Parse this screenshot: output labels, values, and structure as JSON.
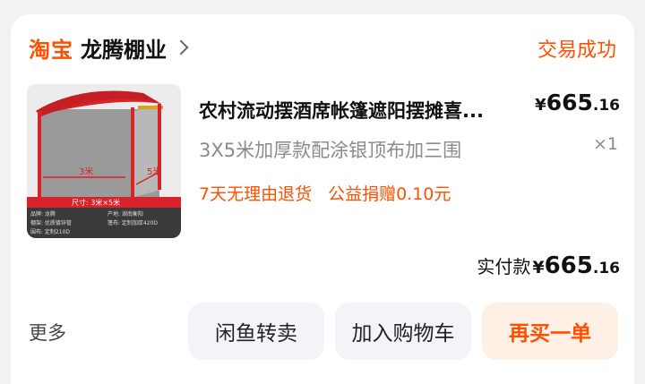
{
  "header": {
    "platform_logo": "淘宝",
    "shop_name": "龙腾棚业",
    "status": "交易成功"
  },
  "product": {
    "title": "农村流动摆酒席帐篷遮阳摆摊喜...",
    "price_currency": "¥",
    "price_int": "665",
    "price_dec": ".16",
    "sku": "3X5米加厚款配涂银顶布加三围",
    "quantity": "×1",
    "tags": [
      "7天无理由退货",
      "公益捐赠0.10元"
    ],
    "image": {
      "label_width": "3米",
      "label_depth": "5米",
      "banner": "尺寸: 3米×5米",
      "spec_rows": [
        [
          "品牌: 龙腾",
          "产地: 湖南衡阳"
        ],
        [
          "棚架: 优质镀锌管",
          "篷布: 定制加厚420D"
        ],
        [
          "围布: 定制210D",
          ""
        ]
      ]
    }
  },
  "payment": {
    "label": "实付款",
    "currency": "¥",
    "int": "665",
    "dec": ".16"
  },
  "actions": {
    "more": "更多",
    "resell": "闲鱼转卖",
    "add_cart": "加入购物车",
    "rebuy": "再买一单"
  },
  "colors": {
    "accent": "#ff5000",
    "tent_red": "#d8232a",
    "background": "#f2f2f4"
  }
}
